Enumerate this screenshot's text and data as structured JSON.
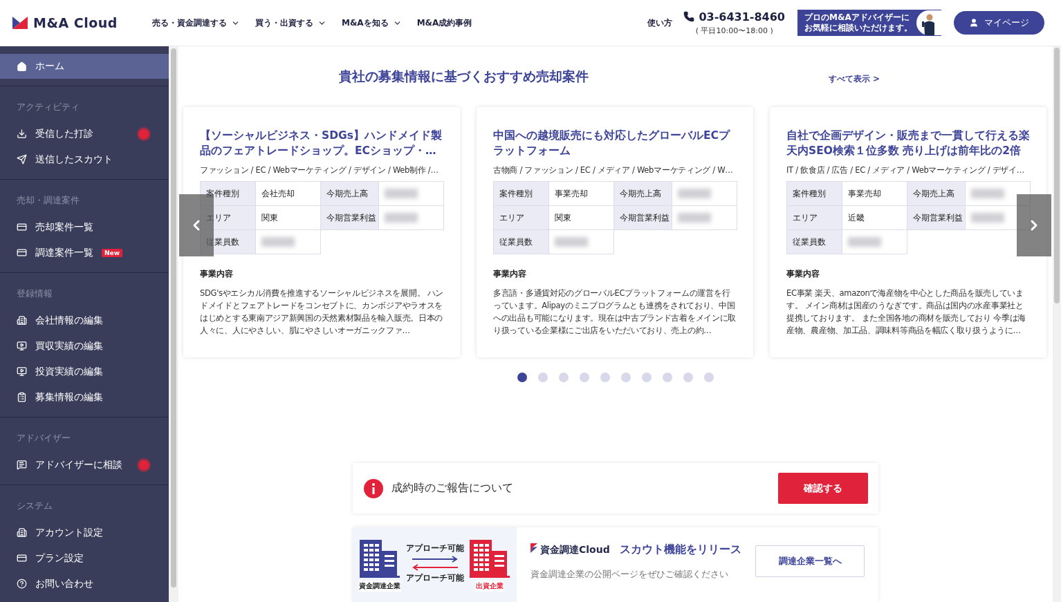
{
  "header": {
    "logo": "M&A Cloud",
    "nav": [
      {
        "label": "売る・資金調達する",
        "dropdown": true
      },
      {
        "label": "買う・出資する",
        "dropdown": true
      },
      {
        "label": "M&Aを知る",
        "dropdown": true
      },
      {
        "label": "M&A成約事例",
        "dropdown": false
      }
    ],
    "help": "使い方",
    "phone": "03-6431-8460",
    "hours": "( 平日10:00〜18:00 )",
    "advisor_banner": [
      "プロのM&Aアドバイザーに",
      "お気軽に相談いただけます。"
    ],
    "mypage": "マイページ"
  },
  "sidebar": {
    "home": {
      "label": "ホーム",
      "selected": true
    },
    "sections": [
      {
        "heading": "アクティビティ",
        "items": [
          {
            "label": "受信した打診",
            "selected": false,
            "notification": true
          },
          {
            "label": "送信したスカウト",
            "selected": false,
            "notification": false
          }
        ]
      },
      {
        "heading": "売却・調達案件",
        "items": [
          {
            "label": "売却案件一覧",
            "selected": false,
            "notification": false
          },
          {
            "label": "調達案件一覧",
            "selected": false,
            "notification": false,
            "badge": "New"
          }
        ]
      },
      {
        "heading": "登録情報",
        "items": [
          {
            "label": "会社情報の編集",
            "selected": false,
            "notification": false
          },
          {
            "label": "買収実績の編集",
            "selected": false,
            "notification": false
          },
          {
            "label": "投資実績の編集",
            "selected": false,
            "notification": false
          },
          {
            "label": "募集情報の編集",
            "selected": false,
            "notification": false
          }
        ]
      },
      {
        "heading": "アドバイザー",
        "items": [
          {
            "label": "アドバイザーに相談",
            "selected": false,
            "notification": true
          }
        ]
      },
      {
        "heading": "システム",
        "items": [
          {
            "label": "アカウント設定",
            "selected": false,
            "notification": false
          },
          {
            "label": "プラン設定",
            "selected": false,
            "notification": false
          },
          {
            "label": "お問い合わせ",
            "selected": false,
            "notification": false
          }
        ]
      }
    ]
  },
  "recommendations": {
    "title": "貴社の募集情報に基づくおすすめ売却案件",
    "show_all": "すべて表示 >",
    "cards": [
      {
        "title": "【ソーシャルビジネス・SDGs】ハンドメイド製品のフェアトレードショップ。ECショップ・…",
        "tags": "ファッション / EC / Webマーケティング / デザイン / Web制作 /…",
        "fields": [
          {
            "label": "案件種別",
            "value": "会社売却"
          },
          {
            "label": "今期売上高"
          },
          {
            "label": "エリア",
            "value": "関東"
          },
          {
            "label": "今期営業利益"
          },
          {
            "label": "従業員数"
          }
        ],
        "section_label": "事業内容",
        "description": "SDG'sやエシカル消費を推進するソーシャルビジネスを展開。 ハンドメイドとフェアトレードをコンセプトに、カンボジアやラオスをはじめとする東南アジア新興国の天然素材製品を輸入販売。日本の人々に、人にやさしい、肌にやさしいオーガニックファ…"
      },
      {
        "title": "中国への越境販売にも対応したグローバルECプラットフォーム",
        "tags": "古物商 / ファッション / EC / メディア / Webマーケティング / W…",
        "fields": [
          {
            "label": "案件種別",
            "value": "事業売却"
          },
          {
            "label": "今期売上高"
          },
          {
            "label": "エリア",
            "value": "関東"
          },
          {
            "label": "今期営業利益"
          },
          {
            "label": "従業員数"
          }
        ],
        "section_label": "事業内容",
        "description": "多言語・多通貨対応のグローバルECプラットフォームの運営を行っています。Alipayのミニプログラムとも連携をされており、中国への出品も可能になります。現在は中古ブランド古着をメインに取り扱っている企業様にご出店をいただいており、売上の約…"
      },
      {
        "title": "自社で企画デザイン・販売まで一貫して行える楽天内SEO検索１位多数 売り上げは前年比の2倍",
        "tags": "IT / 飲食店 / 広告 / EC / メディア / Webマーケティング / デザイ…",
        "fields": [
          {
            "label": "案件種別",
            "value": "事業売却"
          },
          {
            "label": "今期売上高"
          },
          {
            "label": "エリア",
            "value": "近畿"
          },
          {
            "label": "今期営業利益"
          },
          {
            "label": "従業員数"
          }
        ],
        "section_label": "事業内容",
        "description": "EC事業 楽天、amazonで海産物を中心とした商品を販売しています。 メイン商材は国産のうなぎです。商品は国内の水産事業社と提携しております。 また全国各地の商材を販売しており 今季は海産物、農産物、加工品、調味料等商品を幅広く取り扱うように…"
      }
    ],
    "dots": [
      {
        "selected": true
      },
      {
        "selected": false
      },
      {
        "selected": false
      },
      {
        "selected": false
      },
      {
        "selected": false
      },
      {
        "selected": false
      },
      {
        "selected": false
      },
      {
        "selected": false
      },
      {
        "selected": false
      },
      {
        "selected": false
      }
    ]
  },
  "notice": {
    "text": "成約時のご報告について",
    "button": "確認する"
  },
  "promo": {
    "approach_top": "アプローチ可能",
    "approach_bottom": "アプローチ可能",
    "left_label": "資金調達企業",
    "right_label": "出資企業",
    "brand": "資金調達Cloud",
    "title": "スカウト機能をリリース",
    "subtitle": "資金調達企業の公開ページをぜひご確認ください",
    "button": "調達企業一覧へ"
  }
}
